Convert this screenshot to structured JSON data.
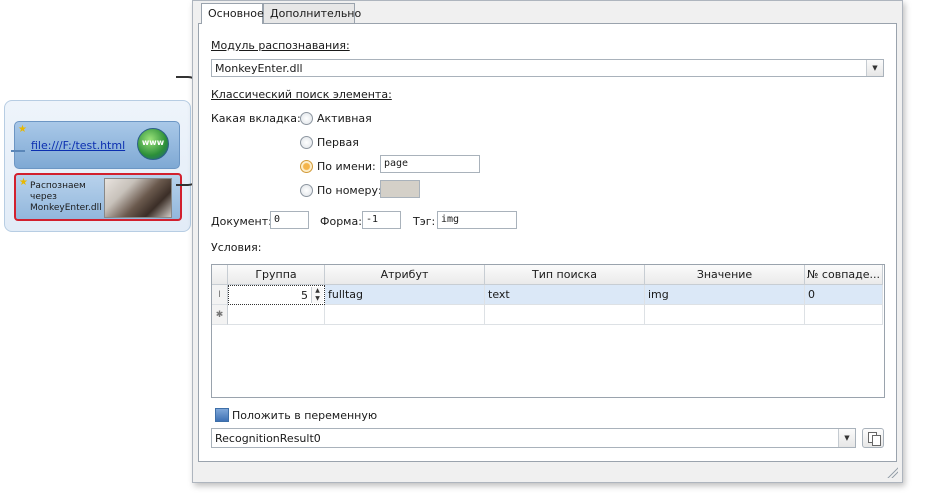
{
  "diagram": {
    "url_node_label": "file:///F:/test.html",
    "www_label": "www",
    "rec_node_label": "Распознаем через MonkeyEnter.dll"
  },
  "tabs": [
    {
      "label": "Основное",
      "active": true
    },
    {
      "label": "Дополнительно",
      "active": false
    }
  ],
  "module": {
    "label": "Модуль распознавания:",
    "value": "MonkeyEnter.dll"
  },
  "classic": {
    "label": "Классический поиск элемента:",
    "tab_question": "Какая вкладка:",
    "options": [
      {
        "label": "Активная",
        "selected": false
      },
      {
        "label": "Первая",
        "selected": false
      },
      {
        "label": "По имени:",
        "selected": true,
        "input": "page"
      },
      {
        "label": "По номеру:",
        "selected": false,
        "input": ""
      }
    ]
  },
  "filters": {
    "document_label": "Документ:",
    "document_value": "0",
    "form_label": "Форма:",
    "form_value": "-1",
    "tag_label": "Тэг:",
    "tag_value": "img"
  },
  "conditions": {
    "label": "Условия:",
    "columns": [
      "Группа",
      "Атрибут",
      "Тип поиска",
      "Значение",
      "№ совпаде..."
    ],
    "rows": [
      {
        "group": "5",
        "attribute": "fulltag",
        "search_type": "text",
        "value": "img",
        "match_no": "0"
      }
    ]
  },
  "variable": {
    "checkbox_label": "Положить в переменную",
    "checked": true,
    "value": "RecognitionResult0"
  },
  "colors": {
    "accent": "#3f72b5",
    "selection_border": "#d2202e",
    "row_highlight": "#dbe8f7"
  }
}
